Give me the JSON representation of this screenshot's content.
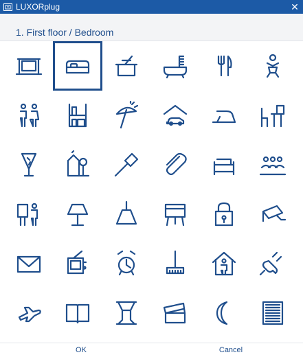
{
  "window": {
    "title": "LUXORplug",
    "close_glyph": "✕",
    "accent_color": "#1c5aa6",
    "icon_color": "#1f4e8c"
  },
  "location": {
    "label": "1. First floor / Bedroom"
  },
  "icons": [
    {
      "name": "monitor-icon",
      "selected": false
    },
    {
      "name": "bed-icon",
      "selected": true
    },
    {
      "name": "cooking-pot-icon",
      "selected": false
    },
    {
      "name": "bathtub-icon",
      "selected": false
    },
    {
      "name": "cutlery-icon",
      "selected": false
    },
    {
      "name": "child-icon",
      "selected": false
    },
    {
      "name": "toilet-people-icon",
      "selected": false
    },
    {
      "name": "shelf-icon",
      "selected": false
    },
    {
      "name": "parasol-icon",
      "selected": false
    },
    {
      "name": "car-garage-icon",
      "selected": false
    },
    {
      "name": "iron-icon",
      "selected": false
    },
    {
      "name": "desk-chair-icon",
      "selected": false
    },
    {
      "name": "cocktail-glass-icon",
      "selected": false
    },
    {
      "name": "garden-icon",
      "selected": false
    },
    {
      "name": "screwdriver-icon",
      "selected": false
    },
    {
      "name": "paperclip-icon",
      "selected": false
    },
    {
      "name": "sofa-icon",
      "selected": false
    },
    {
      "name": "group-icon",
      "selected": false
    },
    {
      "name": "person-board-icon",
      "selected": false
    },
    {
      "name": "table-lamp-icon",
      "selected": false
    },
    {
      "name": "ceiling-lamp-icon",
      "selected": false
    },
    {
      "name": "easel-icon",
      "selected": false
    },
    {
      "name": "padlock-icon",
      "selected": false
    },
    {
      "name": "security-camera-icon",
      "selected": false
    },
    {
      "name": "envelope-icon",
      "selected": false
    },
    {
      "name": "television-icon",
      "selected": false
    },
    {
      "name": "alarm-clock-icon",
      "selected": false
    },
    {
      "name": "broom-icon",
      "selected": false
    },
    {
      "name": "house-person-icon",
      "selected": false
    },
    {
      "name": "power-plug-icon",
      "selected": false
    },
    {
      "name": "airplane-icon",
      "selected": false
    },
    {
      "name": "book-icon",
      "selected": false
    },
    {
      "name": "window-curtain-icon",
      "selected": false
    },
    {
      "name": "box-open-icon",
      "selected": false
    },
    {
      "name": "moon-icon",
      "selected": false
    },
    {
      "name": "shutter-icon",
      "selected": false
    }
  ],
  "footer": {
    "ok_label": "OK",
    "cancel_label": "Cancel"
  }
}
